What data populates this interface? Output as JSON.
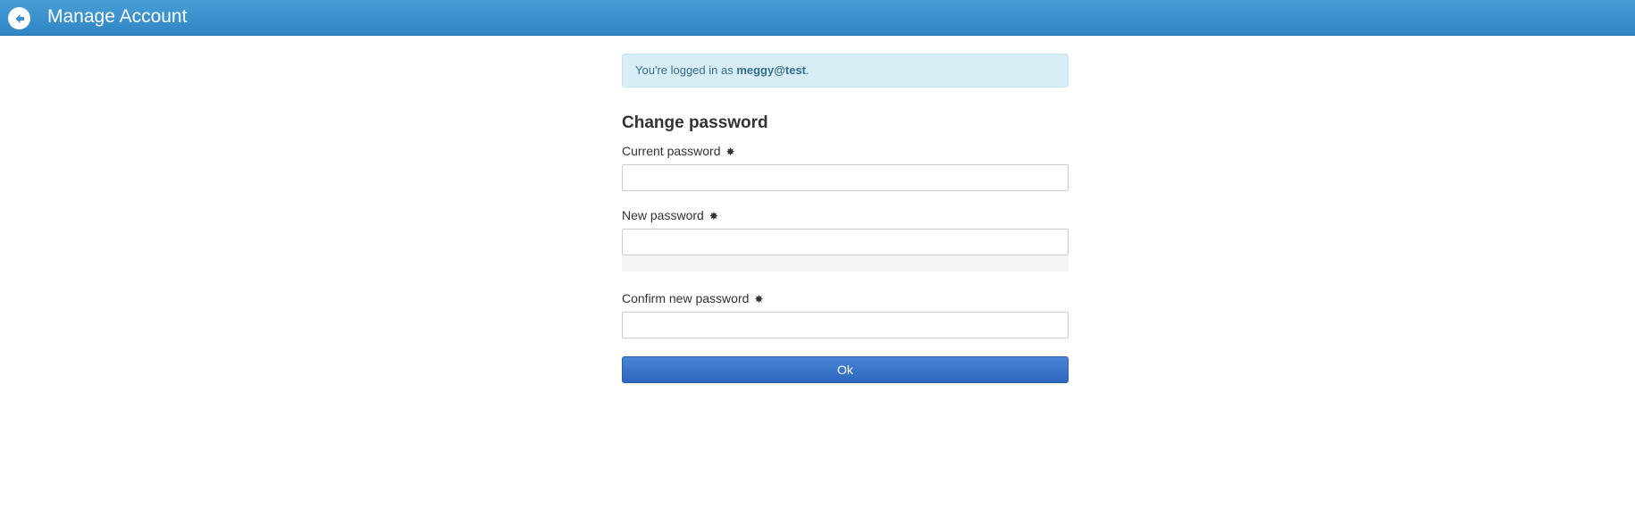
{
  "header": {
    "title": "Manage Account",
    "back_icon": "arrow-left-icon"
  },
  "alert": {
    "prefix": "You're logged in as ",
    "username": "meggy@test",
    "suffix": "."
  },
  "form": {
    "title": "Change password",
    "current_password_label": "Current password",
    "new_password_label": "New password",
    "confirm_password_label": "Confirm new password",
    "required_marker": "✸",
    "submit_label": "Ok"
  },
  "colors": {
    "header": "#3a8fcb",
    "alert_bg": "#d9edf7",
    "button": "#3a76c9"
  }
}
